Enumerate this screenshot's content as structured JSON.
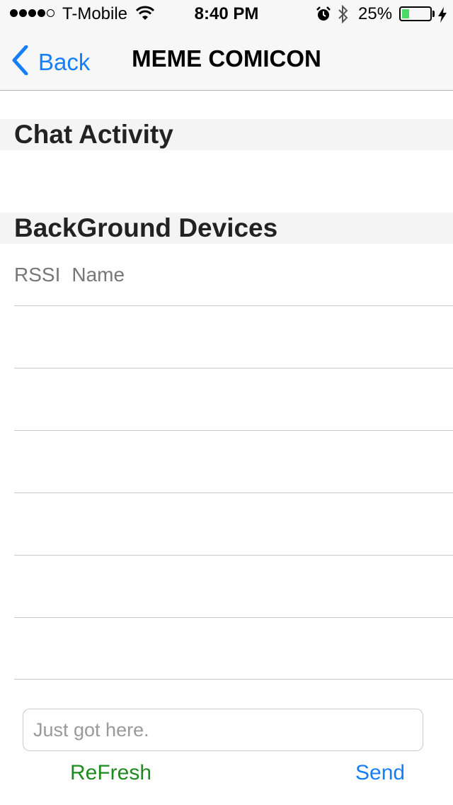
{
  "status_bar": {
    "signal_bars": 4,
    "signal_max": 5,
    "carrier": "T-Mobile",
    "time": "8:40 PM",
    "battery_percent": "25%",
    "battery_level": 0.25,
    "icons": [
      "wifi-icon",
      "alarm-icon",
      "bluetooth-icon",
      "battery-icon",
      "charging-bolt-icon"
    ]
  },
  "nav": {
    "back_label": "Back",
    "title": "MEME COMICON"
  },
  "sections": {
    "chat_activity": "Chat Activity",
    "background_devices": "BackGround Devices"
  },
  "devices": {
    "columns": [
      "RSSI",
      "Name"
    ],
    "rows": [
      "",
      "",
      "",
      "",
      "",
      ""
    ]
  },
  "composer": {
    "placeholder": "Just got here.",
    "refresh_label": "ReFresh",
    "send_label": "Send"
  },
  "colors": {
    "accent": "#157efb",
    "refresh": "#1f8a1f",
    "battery": "#4cd964"
  }
}
